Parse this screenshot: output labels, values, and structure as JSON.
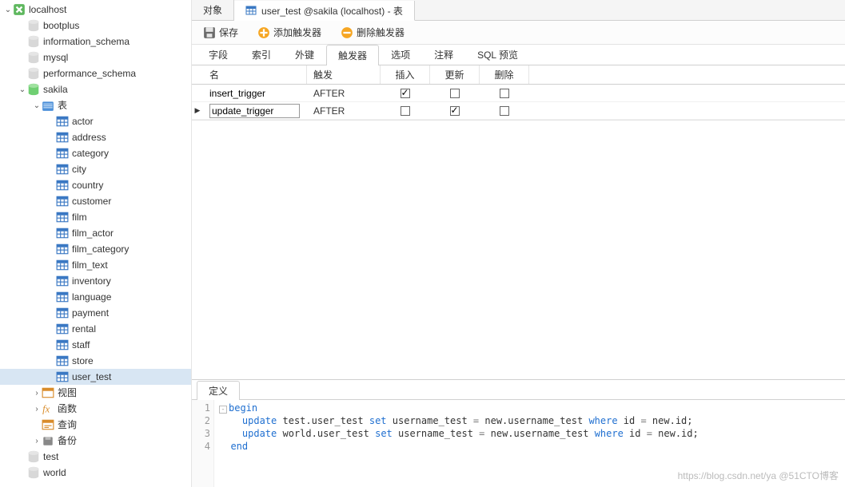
{
  "doc_tabs": [
    {
      "id": "objects",
      "label": "对象",
      "icon": "blank",
      "active": false
    },
    {
      "id": "usertest",
      "label": "user_test @sakila (localhost) - 表",
      "icon": "table",
      "active": true
    }
  ],
  "toolbar": {
    "save": "保存",
    "add_trigger": "添加触发器",
    "delete_trigger": "删除触发器"
  },
  "designer_tabs": [
    {
      "id": "fields",
      "label": "字段"
    },
    {
      "id": "indexes",
      "label": "索引"
    },
    {
      "id": "fk",
      "label": "外键"
    },
    {
      "id": "triggers",
      "label": "触发器",
      "active": true
    },
    {
      "id": "options",
      "label": "选项"
    },
    {
      "id": "comment",
      "label": "注释"
    },
    {
      "id": "sqlprev",
      "label": "SQL 预览"
    }
  ],
  "trigger_grid": {
    "columns": {
      "name": "名",
      "fire": "触发",
      "insert": "插入",
      "update": "更新",
      "delete": "删除"
    },
    "rows": [
      {
        "name": "insert_trigger",
        "fire": "AFTER",
        "ins": true,
        "upd": false,
        "del": false,
        "current": false
      },
      {
        "name": "update_trigger",
        "fire": "AFTER",
        "ins": false,
        "upd": true,
        "del": false,
        "current": true,
        "editing": true
      }
    ]
  },
  "definition_tab": {
    "label": "定义"
  },
  "editor_lines": [
    {
      "n": 1,
      "fold": true,
      "html": "<span class='kw'>begin</span>"
    },
    {
      "n": 2,
      "fold": false,
      "html": "  <span class='kw'>update</span> test.user_test <span class='kw'>set</span> username_test <span class='op'>=</span> new.username_test <span class='kw'>where</span> id <span class='op'>=</span> new.id;"
    },
    {
      "n": 3,
      "fold": false,
      "html": "  <span class='kw'>update</span> world.user_test <span class='kw'>set</span> username_test <span class='op'>=</span> new.username_test <span class='kw'>where</span> id <span class='op'>=</span> new.id;"
    },
    {
      "n": 4,
      "fold": false,
      "html": "<span class='kw'>end</span>"
    }
  ],
  "tree": [
    {
      "depth": 0,
      "twisty": "open",
      "icon": "conn",
      "label": "localhost"
    },
    {
      "depth": 1,
      "twisty": "blank",
      "icon": "db",
      "label": "bootplus"
    },
    {
      "depth": 1,
      "twisty": "blank",
      "icon": "db",
      "label": "information_schema"
    },
    {
      "depth": 1,
      "twisty": "blank",
      "icon": "db",
      "label": "mysql"
    },
    {
      "depth": 1,
      "twisty": "blank",
      "icon": "db",
      "label": "performance_schema"
    },
    {
      "depth": 1,
      "twisty": "open",
      "icon": "dbg",
      "label": "sakila"
    },
    {
      "depth": 2,
      "twisty": "open",
      "icon": "folder",
      "label": "表"
    },
    {
      "depth": 3,
      "twisty": "blank",
      "icon": "table",
      "label": "actor"
    },
    {
      "depth": 3,
      "twisty": "blank",
      "icon": "table",
      "label": "address"
    },
    {
      "depth": 3,
      "twisty": "blank",
      "icon": "table",
      "label": "category"
    },
    {
      "depth": 3,
      "twisty": "blank",
      "icon": "table",
      "label": "city"
    },
    {
      "depth": 3,
      "twisty": "blank",
      "icon": "table",
      "label": "country"
    },
    {
      "depth": 3,
      "twisty": "blank",
      "icon": "table",
      "label": "customer"
    },
    {
      "depth": 3,
      "twisty": "blank",
      "icon": "table",
      "label": "film"
    },
    {
      "depth": 3,
      "twisty": "blank",
      "icon": "table",
      "label": "film_actor"
    },
    {
      "depth": 3,
      "twisty": "blank",
      "icon": "table",
      "label": "film_category"
    },
    {
      "depth": 3,
      "twisty": "blank",
      "icon": "table",
      "label": "film_text"
    },
    {
      "depth": 3,
      "twisty": "blank",
      "icon": "table",
      "label": "inventory"
    },
    {
      "depth": 3,
      "twisty": "blank",
      "icon": "table",
      "label": "language"
    },
    {
      "depth": 3,
      "twisty": "blank",
      "icon": "table",
      "label": "payment"
    },
    {
      "depth": 3,
      "twisty": "blank",
      "icon": "table",
      "label": "rental"
    },
    {
      "depth": 3,
      "twisty": "blank",
      "icon": "table",
      "label": "staff"
    },
    {
      "depth": 3,
      "twisty": "blank",
      "icon": "table",
      "label": "store"
    },
    {
      "depth": 3,
      "twisty": "blank",
      "icon": "table",
      "label": "user_test",
      "selected": true
    },
    {
      "depth": 2,
      "twisty": "closed",
      "icon": "view",
      "label": "视图"
    },
    {
      "depth": 2,
      "twisty": "closed",
      "icon": "fx",
      "label": "函数"
    },
    {
      "depth": 2,
      "twisty": "blank",
      "icon": "query",
      "label": "查询"
    },
    {
      "depth": 2,
      "twisty": "closed",
      "icon": "backup",
      "label": "备份"
    },
    {
      "depth": 1,
      "twisty": "blank",
      "icon": "db",
      "label": "test"
    },
    {
      "depth": 1,
      "twisty": "blank",
      "icon": "db",
      "label": "world"
    }
  ],
  "watermark": "https://blog.csdn.net/ya  @51CTO博客"
}
